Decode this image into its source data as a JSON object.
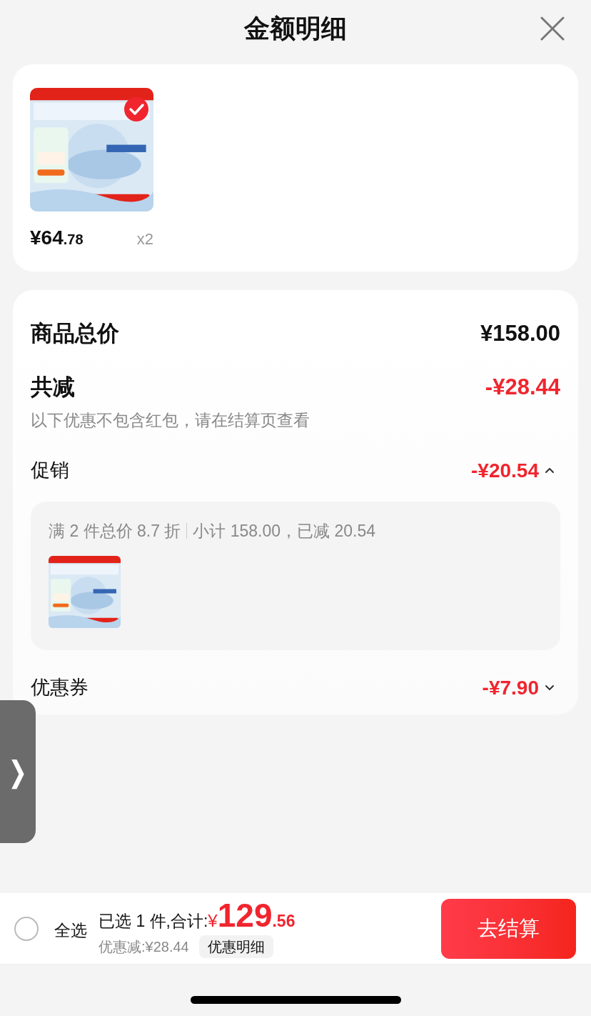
{
  "header": {
    "title": "金额明细"
  },
  "products": [
    {
      "selected": true,
      "price_main": "¥64",
      "price_decimal": ".78",
      "quantity": "x2"
    }
  ],
  "summary": {
    "total_label": "商品总价",
    "total_value": "¥158.00",
    "reduce_label": "共减",
    "reduce_value": "-¥28.44",
    "reduce_note": "以下优惠不包含红包，请在结算页查看"
  },
  "discounts": [
    {
      "label": "促销",
      "value": "-¥20.54",
      "expanded": true,
      "detail": {
        "rule": "满 2 件总价 8.7 折",
        "subtotal": "小计 158.00，已减 20.54"
      }
    },
    {
      "label": "优惠券",
      "value": "-¥7.90",
      "expanded": false
    }
  ],
  "side_tab": {
    "glyph": "❭"
  },
  "bottom_bar": {
    "select_all": {
      "label": "全选",
      "checked": false
    },
    "selected_text": "已选 1 件,合计:",
    "currency": "¥",
    "total_main": "129",
    "total_decimal": ".56",
    "saving": "优惠减:¥28.44",
    "details_button": "优惠明细",
    "checkout": "去结算"
  }
}
